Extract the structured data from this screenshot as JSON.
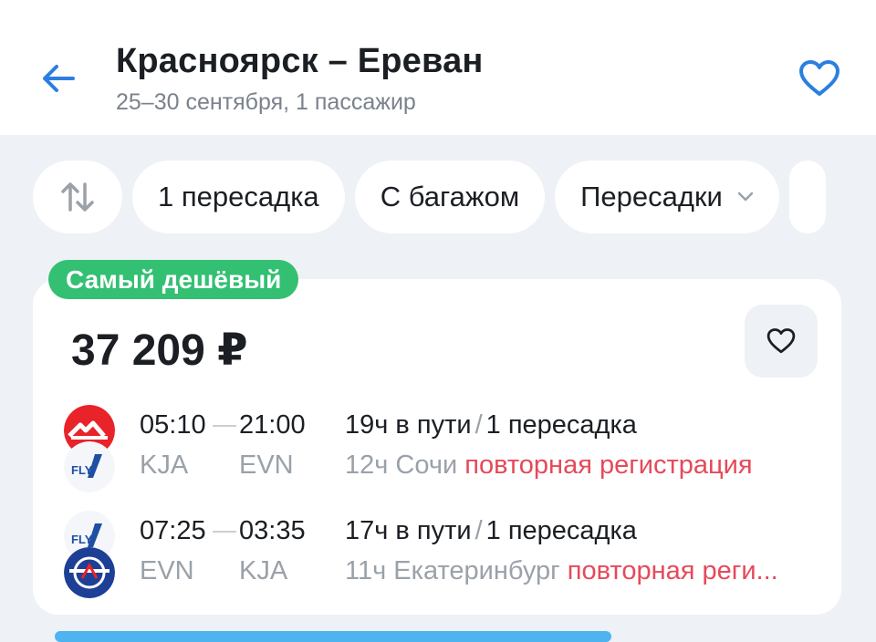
{
  "header": {
    "title": "Красноярск – Ереван",
    "subtitle": "25–30 сентября, 1 пассажир"
  },
  "filters": {
    "chips": [
      "1 пересадка",
      "С багажом",
      "Пересадки"
    ]
  },
  "card": {
    "badge": "Самый дешёвый",
    "price": "37 209 ₽",
    "segments": [
      {
        "dep_time": "05:10",
        "arr_time": "21:00",
        "dep_code": "KJA",
        "arr_code": "EVN",
        "duration": "19ч в пути",
        "stops": "1 пересадка",
        "layover": "12ч Сочи",
        "warning": "повторная регистрация"
      },
      {
        "dep_time": "07:25",
        "arr_time": "03:35",
        "dep_code": "EVN",
        "arr_code": "KJA",
        "duration": "17ч в пути",
        "stops": "1 пересадка",
        "layover": "11ч Екатеринбург",
        "warning": "повторная реги..."
      }
    ]
  },
  "colors": {
    "accent": "#2b7fe0",
    "badge": "#33c073",
    "warning": "#e54a5a",
    "muted": "#9aa1a9"
  },
  "icons": [
    "back-arrow-icon",
    "heart-icon",
    "sort-icon",
    "chevron-down-icon",
    "airline-logo-icon"
  ]
}
